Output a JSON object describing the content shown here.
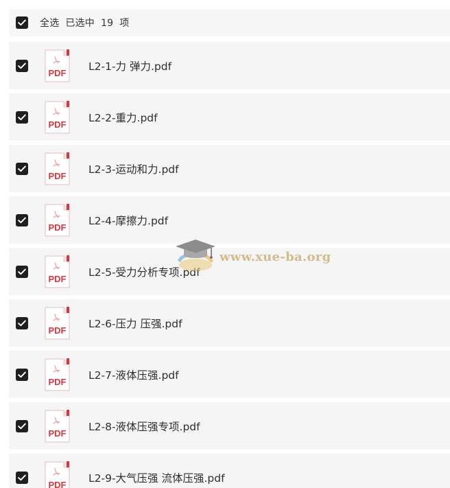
{
  "header": {
    "select_all_label": "全选",
    "selected_prefix": "已选中",
    "selected_count": "19",
    "selected_suffix": "项",
    "checked": true
  },
  "icons": {
    "checkbox": "checkbox-checked-icon",
    "file": "pdf-file-icon",
    "file_badge": "PDF"
  },
  "files": [
    {
      "name": "L2-1-力 弹力.pdf",
      "checked": true
    },
    {
      "name": "L2-2-重力.pdf",
      "checked": true
    },
    {
      "name": "L2-3-运动和力.pdf",
      "checked": true
    },
    {
      "name": "L2-4-摩擦力.pdf",
      "checked": true
    },
    {
      "name": "L2-5-受力分析专项.pdf",
      "checked": true
    },
    {
      "name": "L2-6-压力 压强.pdf",
      "checked": true
    },
    {
      "name": "L2-7-液体压强.pdf",
      "checked": true
    },
    {
      "name": "L2-8-液体压强专项.pdf",
      "checked": true
    },
    {
      "name": "L2-9-大气压强 流体压强.pdf",
      "checked": true
    }
  ],
  "watermark": {
    "text": "www.xue-ba.org"
  },
  "colors": {
    "row_bg": "#f5f5f5",
    "checkbox": "#1f1f1f",
    "pdf_red": "#d9363e",
    "watermark": "#cdb278"
  }
}
